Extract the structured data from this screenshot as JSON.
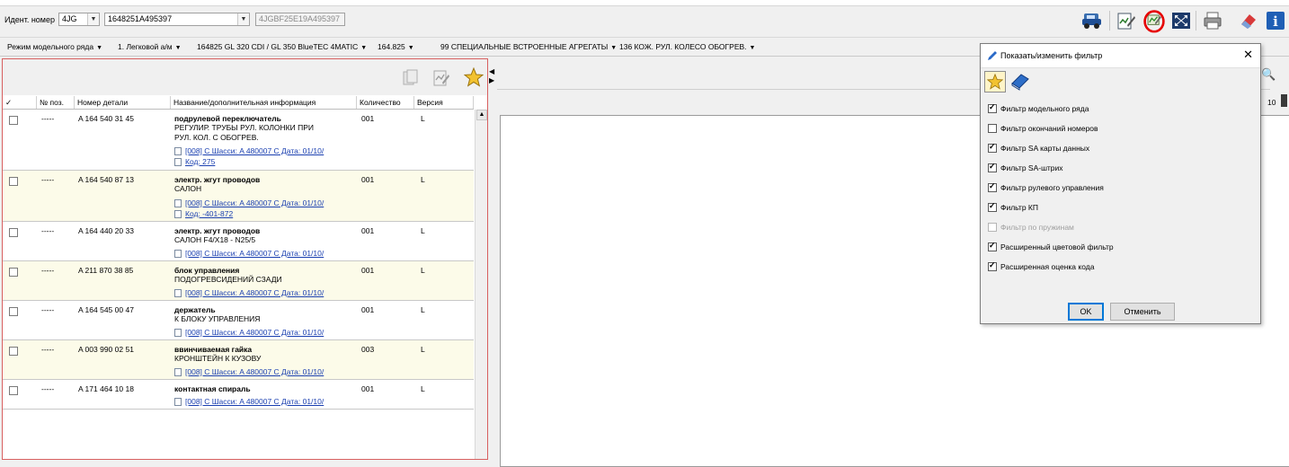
{
  "toolbar": {
    "ident_label": "Идент. номер",
    "ident_prefix": "4JG",
    "vin": "1648251A495397",
    "full_vin": "4JGBF25E19A495397"
  },
  "crumbs": [
    {
      "label": "Режим модельного ряда"
    },
    {
      "label": "1. Легковой а/м"
    },
    {
      "label": "164825 GL 320 CDI / GL 350 BlueTEC 4MATIC"
    },
    {
      "label": "164.825"
    },
    {
      "label": "99 СПЕЦИАЛЬНЫЕ ВСТРОЕННЫЕ АГРЕГАТЫ"
    },
    {
      "label": "136 КОЖ. РУЛ. КОЛЕСО ОБОГРЕВ."
    }
  ],
  "table": {
    "headers": {
      "check": "✓",
      "pos": "№ поз.",
      "part": "Номер детали",
      "name": "Название/дополнительная информация",
      "qty": "Количество",
      "ver": "Версия"
    },
    "rows": [
      {
        "pos": "-----",
        "part": "A 164 540 31 45",
        "name": "подрулевой переключатель",
        "desc1": "РЕГУЛИР. ТРУБЫ РУЛ. КОЛОНКИ ПРИ",
        "desc2": "РУЛ. КОЛ. С ОБОГРЕВ.",
        "link1": "[008] С Шасси: A 480007 С Дата: 01/10/",
        "link2": "Код: 275",
        "qty": "001",
        "ver": "L"
      },
      {
        "pos": "-----",
        "part": "A 164 540 87 13",
        "name": "электр. жгут проводов",
        "desc1": "САЛОН",
        "desc2": "",
        "link1": "[008] С Шасси: A 480007 С Дата: 01/10/",
        "link2": "Код: -401-872",
        "qty": "001",
        "ver": "L"
      },
      {
        "pos": "-----",
        "part": "A 164 440 20 33",
        "name": "электр. жгут проводов",
        "desc1": "САЛОН F4/X18 - N25/5",
        "desc2": "",
        "link1": "[008] С Шасси: A 480007 С Дата: 01/10/",
        "link2": "",
        "qty": "001",
        "ver": "L"
      },
      {
        "pos": "-----",
        "part": "A 211 870 38 85",
        "name": "блок управления",
        "desc1": "ПОДОГРЕВСИДЕНИЙ СЗАДИ",
        "desc2": "",
        "link1": "[008] С Шасси: A 480007 С Дата: 01/10/",
        "link2": "",
        "qty": "001",
        "ver": "L"
      },
      {
        "pos": "-----",
        "part": "A 164 545 00 47",
        "name": "держатель",
        "desc1": "К БЛОКУ УПРАВЛЕНИЯ",
        "desc2": "",
        "link1": "[008] С Шасси: A 480007 С Дата: 01/10/",
        "link2": "",
        "qty": "001",
        "ver": "L"
      },
      {
        "pos": "-----",
        "part": "A 003 990 02 51",
        "name": "ввинчиваемая гайка",
        "desc1": "КРОНШТЕЙН К КУЗОВУ",
        "desc2": "",
        "link1": "[008] С Шасси: A 480007 С Дата: 01/10/",
        "link2": "",
        "qty": "003",
        "ver": "L"
      },
      {
        "pos": "-----",
        "part": "A 171 464 10 18",
        "name": "контактная спираль",
        "desc1": "",
        "desc2": "",
        "link1": "[008] С Шасси: A 480007 С Дата: 01/10/",
        "link2": "",
        "qty": "001",
        "ver": "L"
      }
    ]
  },
  "right": {
    "page_num": "10"
  },
  "dialog": {
    "title": "Показать/изменить фильтр",
    "filters": [
      {
        "label": "Фильтр модельного ряда",
        "checked": true,
        "disabled": false
      },
      {
        "label": "Фильтр окончаний номеров",
        "checked": false,
        "disabled": false
      },
      {
        "label": "Фильтр SA карты данных",
        "checked": true,
        "disabled": false
      },
      {
        "label": "Фильтр SA-штрих",
        "checked": true,
        "disabled": false
      },
      {
        "label": "Фильтр рулевого управления",
        "checked": true,
        "disabled": false
      },
      {
        "label": "Фильтр КП",
        "checked": true,
        "disabled": false
      },
      {
        "label": "Фильтр по пружинам",
        "checked": false,
        "disabled": true
      },
      {
        "label": "Расширенный цветовой фильтр",
        "checked": true,
        "disabled": false
      },
      {
        "label": "Расширенная оценка кода",
        "checked": true,
        "disabled": false
      }
    ],
    "ok_label": "OK",
    "cancel_label": "Отменить"
  },
  "colors": {
    "alt_row": "#fcfbe9",
    "link": "#1a3fb0",
    "annotation": "#e60000",
    "panel_border": "#d86060"
  }
}
